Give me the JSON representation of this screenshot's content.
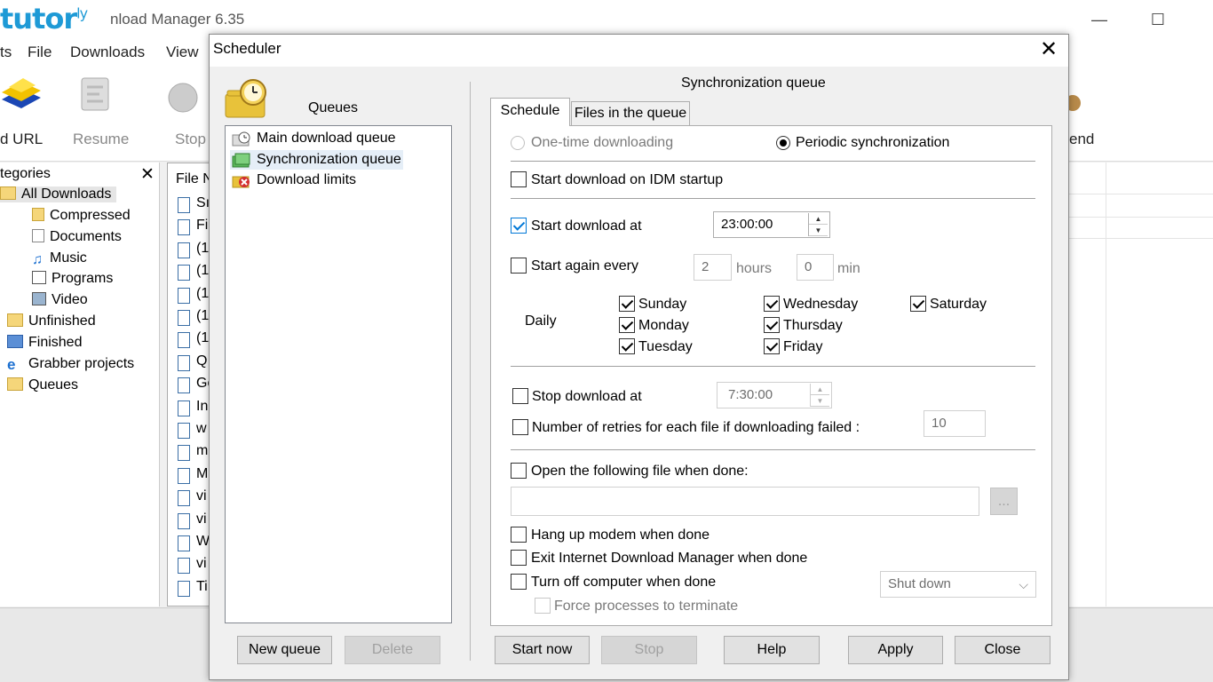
{
  "background": {
    "logo": "tutor",
    "logo_sup": "ly",
    "app_title": "nload Manager 6.35",
    "menu": [
      "ts",
      "File",
      "Downloads",
      "View"
    ],
    "toolbar": [
      "d URL",
      "Resume",
      "Stop",
      "end"
    ],
    "categories_header": "tegories",
    "file_col_header": "File N",
    "categories": [
      {
        "label": "All Downloads",
        "icon": "folder-open-icon"
      },
      {
        "label": "Compressed",
        "icon": "archive-icon"
      },
      {
        "label": "Documents",
        "icon": "document-icon"
      },
      {
        "label": "Music",
        "icon": "music-icon"
      },
      {
        "label": "Programs",
        "icon": "program-icon"
      },
      {
        "label": "Video",
        "icon": "video-icon"
      },
      {
        "label": "Unfinished",
        "icon": "unfinished-icon"
      },
      {
        "label": "Finished",
        "icon": "finished-icon"
      },
      {
        "label": "Grabber projects",
        "icon": "ie-icon"
      },
      {
        "label": "Queues",
        "icon": "folder-icon"
      }
    ],
    "file_rows": [
      "Sı",
      "Fi",
      "(1",
      "(1",
      "(1",
      "(1",
      "(1",
      "Q",
      "Go",
      "In",
      "w",
      "m",
      "M",
      "vi",
      "vi",
      "W",
      "vi",
      "Ti"
    ]
  },
  "dialog": {
    "title": "Scheduler",
    "close_glyph": "✕",
    "queues_label": "Queues",
    "queues": [
      {
        "label": "Main download queue",
        "icon": "queue-clock-icon",
        "selected": false
      },
      {
        "label": "Synchronization queue",
        "icon": "queue-sync-icon",
        "selected": true
      },
      {
        "label": "Download limits",
        "icon": "download-limits-icon",
        "selected": false
      }
    ],
    "new_queue_button": "New queue",
    "delete_button": "Delete",
    "section_title": "Synchronization queue",
    "tabs": [
      "Schedule",
      "Files in the queue"
    ],
    "one_time_label": "One-time downloading",
    "periodic_label": "Periodic synchronization",
    "start_on_startup_label": "Start download on IDM startup",
    "start_at_label": "Start download at",
    "start_at_value": "23:00:00",
    "start_again_label": "Start again every",
    "hours_value": "2",
    "hours_label": "hours",
    "min_value": "0",
    "min_label": "min",
    "daily_label": "Daily",
    "days": [
      "Sunday",
      "Monday",
      "Tuesday",
      "Wednesday",
      "Thursday",
      "Friday",
      "Saturday"
    ],
    "stop_at_label": "Stop download at",
    "stop_at_value": "7:30:00",
    "retries_label": "Number of retries for each file if downloading failed :",
    "retries_value": "10",
    "open_file_label": "Open the following file when done:",
    "open_file_value": "",
    "browse_label": "...",
    "hangup_label": "Hang up modem when done",
    "exit_idm_label": "Exit Internet Download Manager when done",
    "turn_off_label": "Turn off computer when done",
    "shutdown_option": "Shut down",
    "force_label": "Force processes to terminate",
    "buttons": {
      "start_now": "Start now",
      "stop": "Stop",
      "help": "Help",
      "apply": "Apply",
      "close": "Close"
    }
  }
}
